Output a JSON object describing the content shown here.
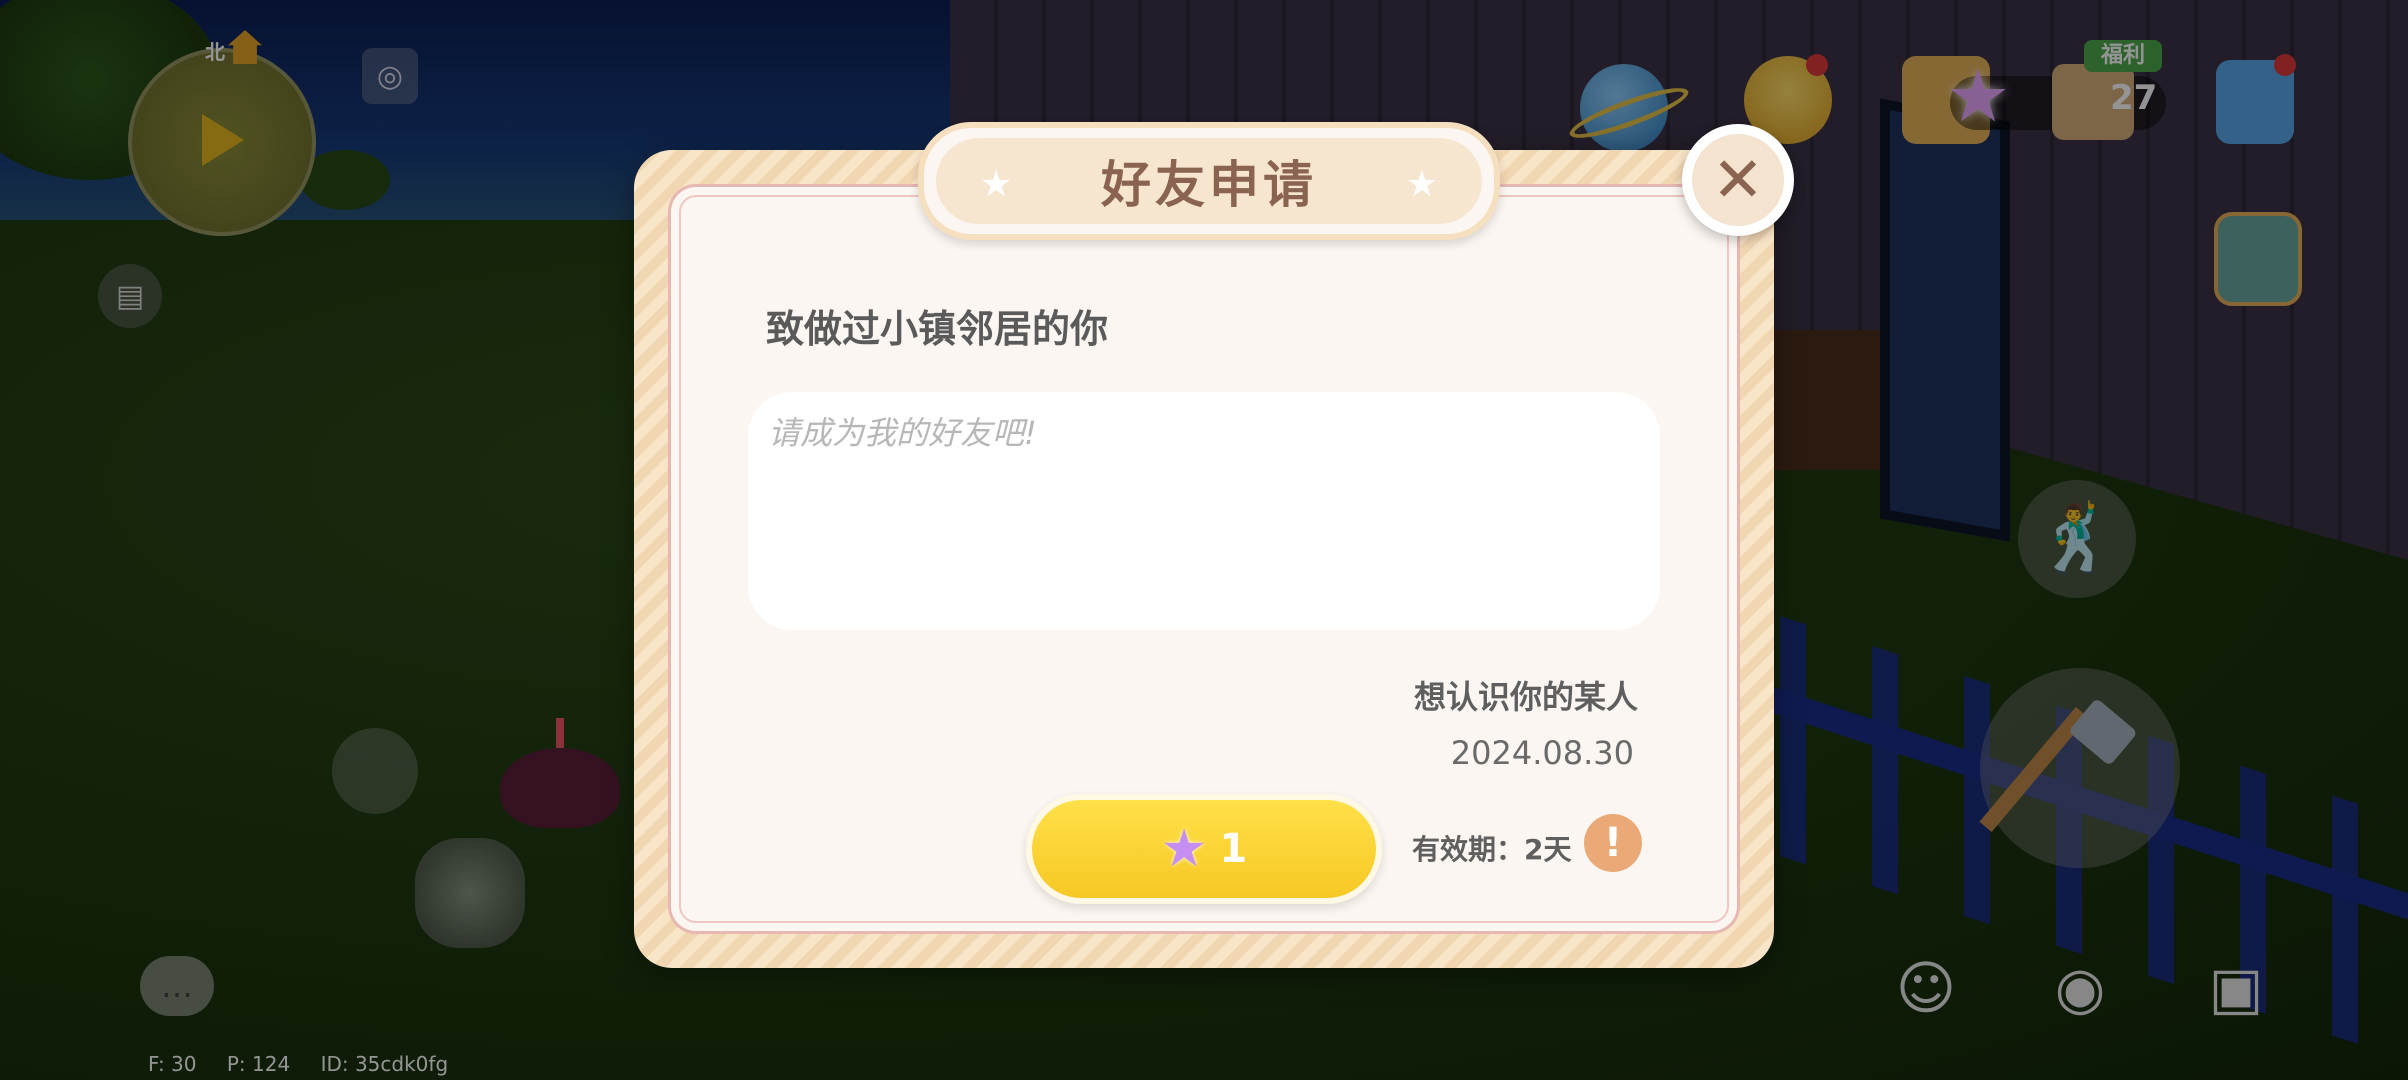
{
  "hud": {
    "minimap_north_label": "北",
    "top_right_star_count": "27",
    "welfare_badge": "福利"
  },
  "dialog": {
    "title": "好友申请",
    "greeting": "致做过小镇邻居的你",
    "message": "请成为我的好友吧!",
    "sender": "想认识你的某人",
    "date": "2024.08.30",
    "accept_cost": "1",
    "validity": "有效期：2天",
    "close_symbol": "✕",
    "info_symbol": "!"
  },
  "debug": {
    "fps": "F: 30",
    "ping": "P: 124",
    "player_id": "ID: 35cdk0fg"
  },
  "icons": {
    "title_star": "★",
    "accept_star": "★",
    "minimap": "map-icon",
    "task": "clipboard-icon",
    "calendar": "calendar-icon",
    "planet": "planet-icon",
    "duck": "duck-icon",
    "gift": "gift-icon",
    "shop": "shop-icon",
    "watch": "smartwatch-icon",
    "backpack": "backpack-icon",
    "dance": "dance-emote-icon",
    "axe": "axe-icon",
    "chat": "chat-icon",
    "emoji": "smiley-icon",
    "camera": "camera-icon",
    "toolbox": "toolbox-icon"
  },
  "colors": {
    "accept_button": "#f6c824",
    "dialog_frame": "#f6dfbf",
    "dialog_body": "#fbf6f1",
    "title_text": "#8a6450",
    "info_icon": "#eaa976"
  }
}
